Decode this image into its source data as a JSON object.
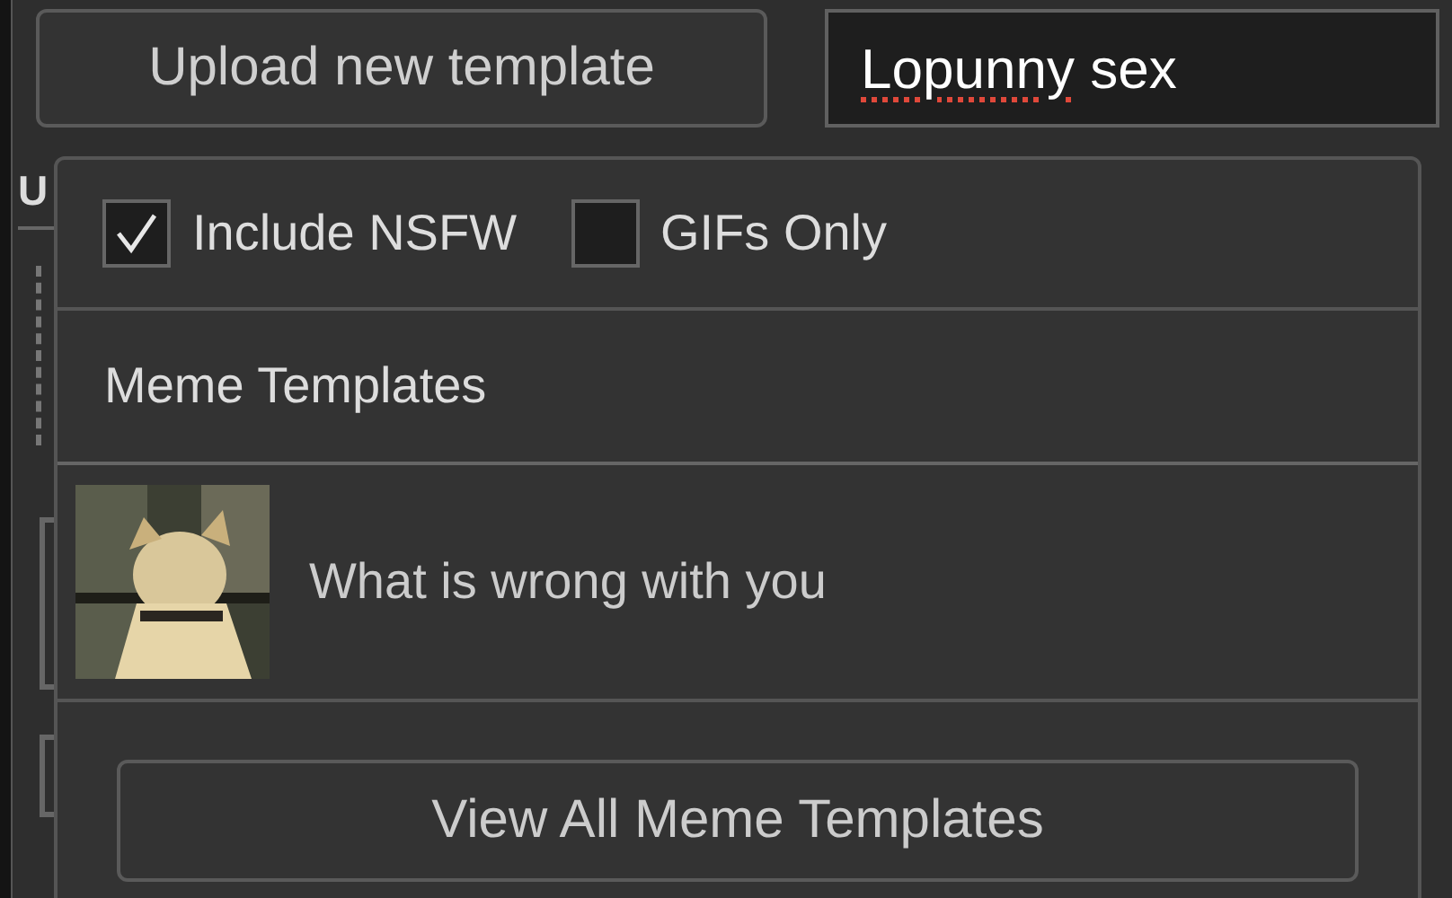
{
  "upload_button": "Upload new template",
  "search": {
    "words": [
      {
        "text": "Lopunny",
        "misspelled": true
      },
      {
        "text": "sex",
        "misspelled": false
      }
    ]
  },
  "background": {
    "heading": "U"
  },
  "dropdown": {
    "filters": [
      {
        "label": "Include NSFW",
        "checked": true
      },
      {
        "label": "GIFs Only",
        "checked": false
      }
    ],
    "section_title": "Meme Templates",
    "results": [
      {
        "title": "What is wrong with you"
      }
    ],
    "view_all_button": "View All Meme Templates"
  }
}
